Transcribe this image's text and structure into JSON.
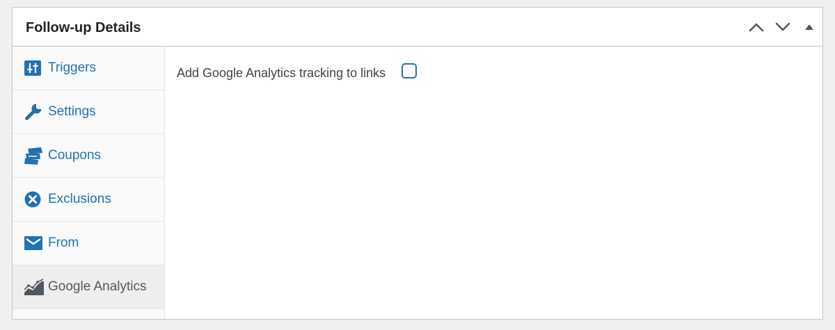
{
  "postbox": {
    "title": "Follow-up Details",
    "actions": [
      {
        "name": "move-up-button",
        "icon": "chevron-up-icon"
      },
      {
        "name": "move-down-button",
        "icon": "chevron-down-icon"
      },
      {
        "name": "toggle-panel-button",
        "icon": "triangle-up-icon"
      }
    ]
  },
  "tabs": [
    {
      "label": "Triggers",
      "icon": "triggers-icon",
      "active": false
    },
    {
      "label": "Settings",
      "icon": "wrench-icon",
      "active": false
    },
    {
      "label": "Coupons",
      "icon": "coupons-icon",
      "active": false
    },
    {
      "label": "Exclusions",
      "icon": "x-circle-icon",
      "active": false
    },
    {
      "label": "From",
      "icon": "envelope-icon",
      "active": false
    },
    {
      "label": "Google Analytics",
      "icon": "analytics-chart-icon",
      "active": true
    }
  ],
  "panel": {
    "field_label": "Add Google Analytics tracking to links",
    "checkbox_checked": false
  },
  "colors": {
    "accent": "#2271b1",
    "active_tab_text": "#50575e",
    "active_tab_bg": "#eeeeee",
    "page_bg": "#f0f0f1"
  }
}
